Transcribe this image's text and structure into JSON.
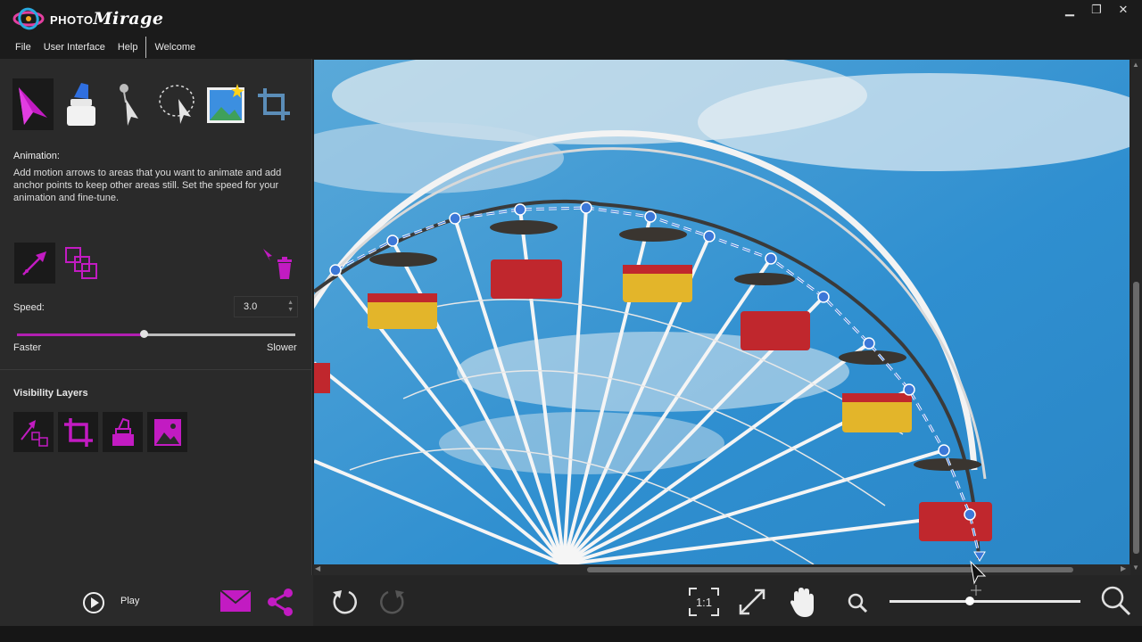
{
  "app": {
    "logo_prefix": "PHOTO",
    "logo_script": "Mirage"
  },
  "window_controls": {
    "minimize": "▁",
    "restore": "❐",
    "close": "✕"
  },
  "menu": {
    "items": [
      "File",
      "User Interface",
      "Help"
    ],
    "welcome": "Welcome"
  },
  "tools": [
    {
      "name": "animation-tool-icon",
      "active": true
    },
    {
      "name": "mask-eraser-tool-icon",
      "active": false
    },
    {
      "name": "anchor-pin-tool-icon",
      "active": false
    },
    {
      "name": "selection-tool-icon",
      "active": false
    },
    {
      "name": "sky-image-tool-icon",
      "active": false
    },
    {
      "name": "crop-tool-icon",
      "active": false
    }
  ],
  "panel": {
    "section_title": "Animation:",
    "description": "Add motion arrows to areas that you want to animate and add anchor points to keep other areas still. Set the speed for your animation and fine-tune.",
    "speed_label": "Speed:",
    "speed_value": "3.0",
    "speed_fraction": 0.455,
    "faster_label": "Faster",
    "slower_label": "Slower",
    "visibility_title": "Visibility Layers"
  },
  "bottom": {
    "play_label": "Play",
    "zoom_fraction": 0.42
  },
  "colors": {
    "accent": "#b21fb2",
    "sky": "#3d9ad6",
    "path_point": "#3c78d8"
  }
}
